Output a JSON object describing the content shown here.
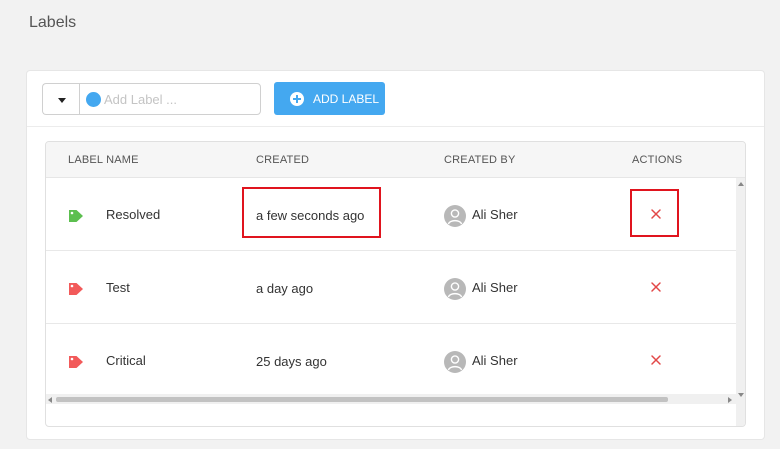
{
  "page": {
    "title": "Labels"
  },
  "toolbar": {
    "input_placeholder": "Add Label ...",
    "add_button_label": "ADD LABEL",
    "selected_color": "#44a8f0"
  },
  "table": {
    "columns": [
      "LABEL NAME",
      "CREATED",
      "CREATED BY",
      "ACTIONS"
    ],
    "rows": [
      {
        "name": "Resolved",
        "created": "a few seconds ago",
        "created_by": "Ali Sher",
        "tag_color": "#5cbf4f",
        "tag_icon": "tag-icon",
        "action_icon": "delete-x-icon"
      },
      {
        "name": "Test",
        "created": "a day ago",
        "created_by": "Ali Sher",
        "tag_color": "#f25a5a",
        "tag_icon": "tag-icon",
        "action_icon": "delete-x-icon"
      },
      {
        "name": "Critical",
        "created": "25 days ago",
        "created_by": "Ali Sher",
        "tag_color": "#f25a5a",
        "tag_icon": "tag-icon",
        "action_icon": "delete-x-icon"
      }
    ]
  },
  "colors": {
    "accent": "#44a8f0",
    "delete": "#e24848",
    "highlight": "#e0141e"
  }
}
